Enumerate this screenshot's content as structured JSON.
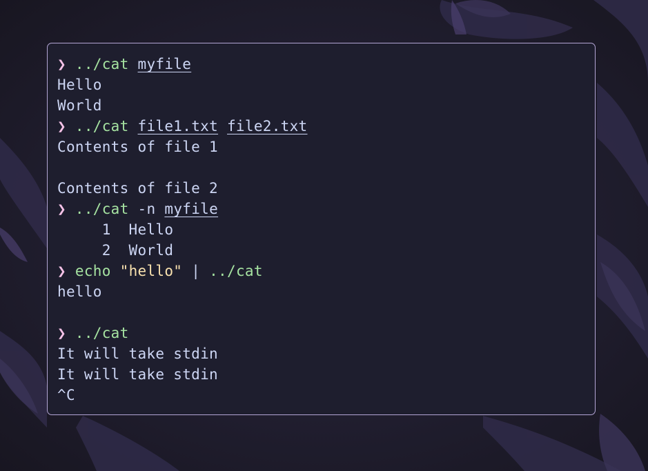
{
  "colors": {
    "terminal_bg": "#1e1e2e",
    "border": "#b4a6d6",
    "prompt": "#f5c2e7",
    "command": "#a6e3a1",
    "string": "#f9e2af",
    "text": "#cdd6f4"
  },
  "terminal": {
    "prompt_symbol": "❯",
    "lines": [
      {
        "kind": "command",
        "cmd": "../cat",
        "args": [
          {
            "text": "myfile",
            "type": "path"
          }
        ]
      },
      {
        "kind": "output",
        "text": "Hello"
      },
      {
        "kind": "output",
        "text": "World"
      },
      {
        "kind": "command",
        "cmd": "../cat",
        "args": [
          {
            "text": "file1.txt",
            "type": "path"
          },
          {
            "text": "file2.txt",
            "type": "path"
          }
        ]
      },
      {
        "kind": "output",
        "text": "Contents of file 1"
      },
      {
        "kind": "output",
        "text": ""
      },
      {
        "kind": "output",
        "text": "Contents of file 2"
      },
      {
        "kind": "command",
        "cmd": "../cat",
        "args": [
          {
            "text": "-n",
            "type": "flag"
          },
          {
            "text": "myfile",
            "type": "path"
          }
        ]
      },
      {
        "kind": "output",
        "text": "     1  Hello"
      },
      {
        "kind": "output",
        "text": "     2  World"
      },
      {
        "kind": "pipeline",
        "cmd": "echo",
        "string": "\"hello\"",
        "pipe": "|",
        "cmd2": "../cat"
      },
      {
        "kind": "output",
        "text": "hello"
      },
      {
        "kind": "output",
        "text": ""
      },
      {
        "kind": "command",
        "cmd": "../cat",
        "args": []
      },
      {
        "kind": "output",
        "text": "It will take stdin"
      },
      {
        "kind": "output",
        "text": "It will take stdin"
      },
      {
        "kind": "output",
        "text": "^C"
      }
    ]
  }
}
